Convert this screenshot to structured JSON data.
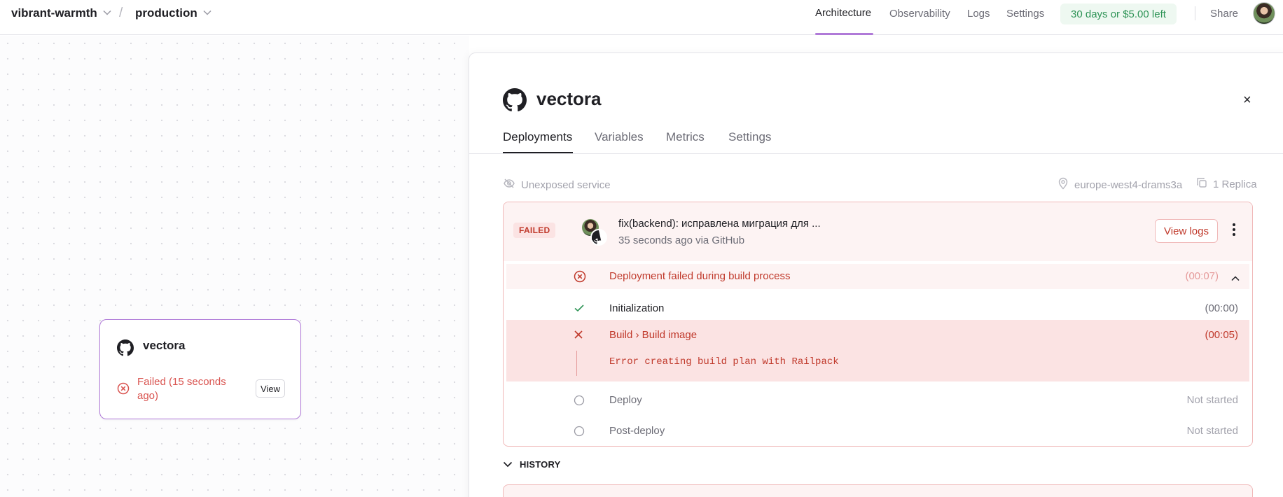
{
  "topbar": {
    "project": "vibrant-warmth",
    "separator": "/",
    "environment": "production",
    "nav": {
      "architecture": "Architecture",
      "observability": "Observability",
      "logs": "Logs",
      "settings": "Settings"
    },
    "trial": "30 days or $5.00 left",
    "share": "Share",
    "accent_color": "#b07ad8",
    "trial_color": "#2f9457"
  },
  "canvas": {
    "node": {
      "title": "vectora",
      "status": "Failed (15 seconds ago)",
      "view_label": "View",
      "icon": "github-icon",
      "status_color": "#d9534f"
    }
  },
  "panel": {
    "title": "vectora",
    "icon": "github-icon",
    "close": "×",
    "tabs": [
      "Deployments",
      "Variables",
      "Metrics",
      "Settings"
    ],
    "active_tab": "Deployments",
    "meta": {
      "exposure": "Unexposed service",
      "region": "europe-west4-drams3a",
      "replicas": "1 Replica"
    },
    "deployment": {
      "status": "FAILED",
      "commit_message": "fix(backend): исправлена миграция для ...",
      "commit_meta": "35 seconds ago via GitHub",
      "view_logs": "View logs",
      "summary": {
        "label": "Deployment failed during build process",
        "duration": "(00:07)"
      },
      "steps": [
        {
          "label": "Initialization",
          "duration": "(00:00)",
          "state": "success"
        },
        {
          "label": "Build › Build image",
          "duration": "(00:05)",
          "state": "failed",
          "error": "Error creating build plan with Railpack"
        },
        {
          "label": "Deploy",
          "duration": "Not started",
          "state": "pending"
        },
        {
          "label": "Post-deploy",
          "duration": "Not started",
          "state": "pending"
        }
      ],
      "error_color": "#c0392b"
    },
    "history_label": "HISTORY"
  }
}
